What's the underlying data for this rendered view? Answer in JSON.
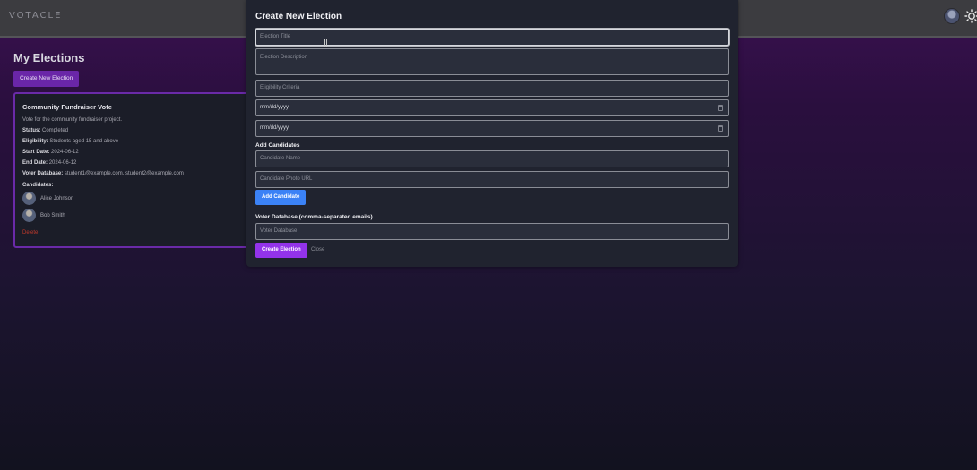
{
  "header": {
    "logo": "VOTACLE"
  },
  "page": {
    "title": "My Elections",
    "create_button": "Create New Election"
  },
  "election_card": {
    "title": "Community Fundraiser Vote",
    "description": "Vote for the community fundraiser project.",
    "fields": [
      {
        "label": "Status:",
        "value": "Completed"
      },
      {
        "label": "Eligibility:",
        "value": "Students aged 15 and above"
      },
      {
        "label": "Start Date:",
        "value": "2024-06-12"
      },
      {
        "label": "End Date:",
        "value": "2024-06-12"
      },
      {
        "label": "Voter Database:",
        "value": "student1@example.com, student2@example.com"
      }
    ],
    "candidates_label": "Candidates:",
    "candidates": [
      {
        "name": "Alice Johnson"
      },
      {
        "name": "Bob Smith"
      }
    ],
    "delete_label": "Delete"
  },
  "modal": {
    "title": "Create New Election",
    "election_title_placeholder": "Election Title",
    "election_description_placeholder": "Election Description",
    "eligibility_placeholder": "Eligibility Criteria",
    "start_date_value": "mm/dd/yyyy",
    "end_date_value": "mm/dd/yyyy",
    "add_candidates_label": "Add Candidates",
    "candidate_name_placeholder": "Candidate Name",
    "candidate_photo_placeholder": "Candidate Photo URL",
    "add_candidate_button": "Add Candidate",
    "voter_db_label": "Voter Database (comma-separated emails)",
    "voter_db_placeholder": "Voter Database",
    "create_button": "Create Election",
    "close_button": "Close"
  },
  "colors": {
    "accent_purple": "#9333ea",
    "accent_blue": "#3b82f6",
    "delete_red": "#c0392b"
  }
}
